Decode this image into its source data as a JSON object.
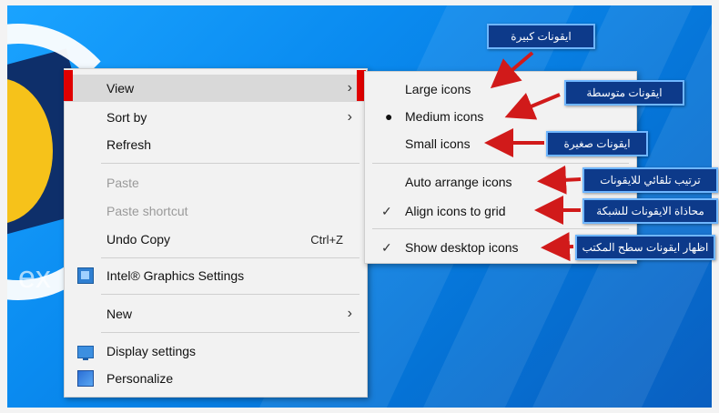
{
  "desktop": {
    "partial_text": "ex"
  },
  "context_menu": {
    "items": [
      {
        "label": "View",
        "has_submenu": true,
        "state": "highlighted"
      },
      {
        "label": "Sort by",
        "has_submenu": true
      },
      {
        "label": "Refresh"
      },
      {
        "label": "Paste",
        "enabled": false
      },
      {
        "label": "Paste shortcut",
        "enabled": false
      },
      {
        "label": "Undo Copy",
        "shortcut": "Ctrl+Z"
      },
      {
        "label": "Intel® Graphics Settings",
        "icon": "intel-graphics-icon"
      },
      {
        "label": "New",
        "has_submenu": true
      },
      {
        "label": "Display settings",
        "icon": "display-settings-icon"
      },
      {
        "label": "Personalize",
        "icon": "personalize-icon"
      }
    ]
  },
  "view_submenu": {
    "items": [
      {
        "label": "Large icons"
      },
      {
        "label": "Medium icons",
        "selected": true
      },
      {
        "label": "Small icons"
      },
      {
        "label": "Auto arrange icons"
      },
      {
        "label": "Align icons to grid",
        "checked": true
      },
      {
        "label": "Show desktop icons",
        "checked": true
      }
    ]
  },
  "annotations": [
    {
      "text": "ايقونات كبيرة"
    },
    {
      "text": "ايقونات متوسطة"
    },
    {
      "text": "ايقونات صغيرة"
    },
    {
      "text": "ترتيب تلقائي للايقونات"
    },
    {
      "text": "محاذاة الايقونات للشبكة"
    },
    {
      "text": "اظهار ايقونات سطح المكتب"
    }
  ],
  "colors": {
    "highlight_marker": "#e00000",
    "annotation_bg": "#0d3a8a",
    "annotation_border": "#6fb6ff",
    "arrow": "#d11a1a"
  }
}
